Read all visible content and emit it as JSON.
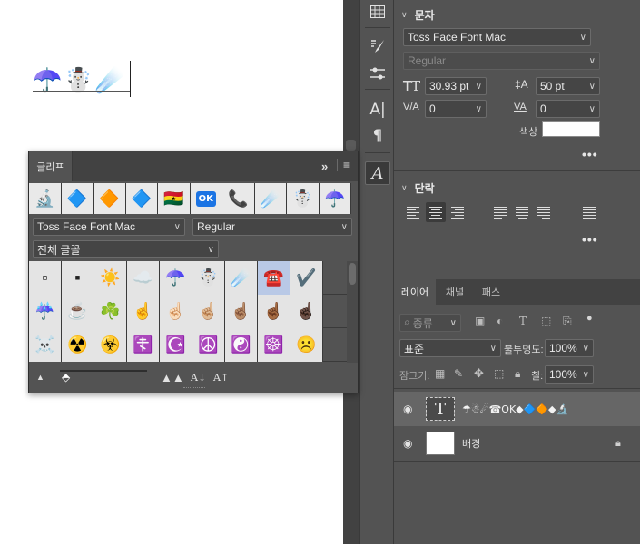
{
  "canvas": {
    "text_glyphs": [
      "☂️",
      "☃️",
      "☄️"
    ]
  },
  "toolstrip": {
    "tools": [
      "table-icon",
      "brush-settings-icon",
      "sliders-icon",
      "character-icon",
      "paragraph-icon",
      "glyphs-icon"
    ]
  },
  "character_panel": {
    "title": "문자",
    "font_family": "Toss Face Font Mac",
    "font_style": "Regular",
    "font_size": "30.93 pt",
    "leading": "50 pt",
    "kerning": "0",
    "tracking": "0",
    "color_label": "색상",
    "more": "•••"
  },
  "paragraph_panel": {
    "title": "단락",
    "more": "•••"
  },
  "layers_panel": {
    "tabs": [
      "레이어",
      "채널",
      "패스"
    ],
    "filter_label": "종류",
    "blend_mode": "표준",
    "opacity_label": "불투명도:",
    "opacity_value": "100%",
    "lock_label": "잠그기:",
    "fill_label": "칠:",
    "fill_value": "100%",
    "layers": [
      {
        "name": "☂☃☄☎OK◆🔷🔶◆🔬",
        "thumb": "T"
      },
      {
        "name": "배경",
        "thumb": ""
      }
    ]
  },
  "glyphs_panel": {
    "tab_label": "글리프",
    "expand_icon": "»",
    "recent": [
      "🔬",
      "🔷",
      "🔶",
      "🔷",
      "🇬🇭",
      "🆗",
      "📞",
      "☄️",
      "☃️",
      "☂️"
    ],
    "font_family": "Toss Face Font Mac",
    "font_style": "Regular",
    "category": "전체 글꼴",
    "grid": [
      [
        "▫",
        "▪",
        "☀️",
        "☁️",
        "☂️",
        "☃️",
        "☄️",
        "☎️",
        "✔️"
      ],
      [
        "☔",
        "☕",
        "☘️",
        "☝️",
        "☝🏻",
        "☝🏼",
        "☝🏽",
        "☝🏾",
        "☝🏿"
      ],
      [
        "☠️",
        "☢️",
        "☣️",
        "☦️",
        "☪️",
        "☮️",
        "☯️",
        "☸️",
        "☹️"
      ]
    ]
  },
  "colors": {
    "panel_bg": "#535353",
    "tab_bg": "#424242",
    "highlight_cell": "#b9c9e6",
    "ok_blue": "#1b74e4"
  }
}
